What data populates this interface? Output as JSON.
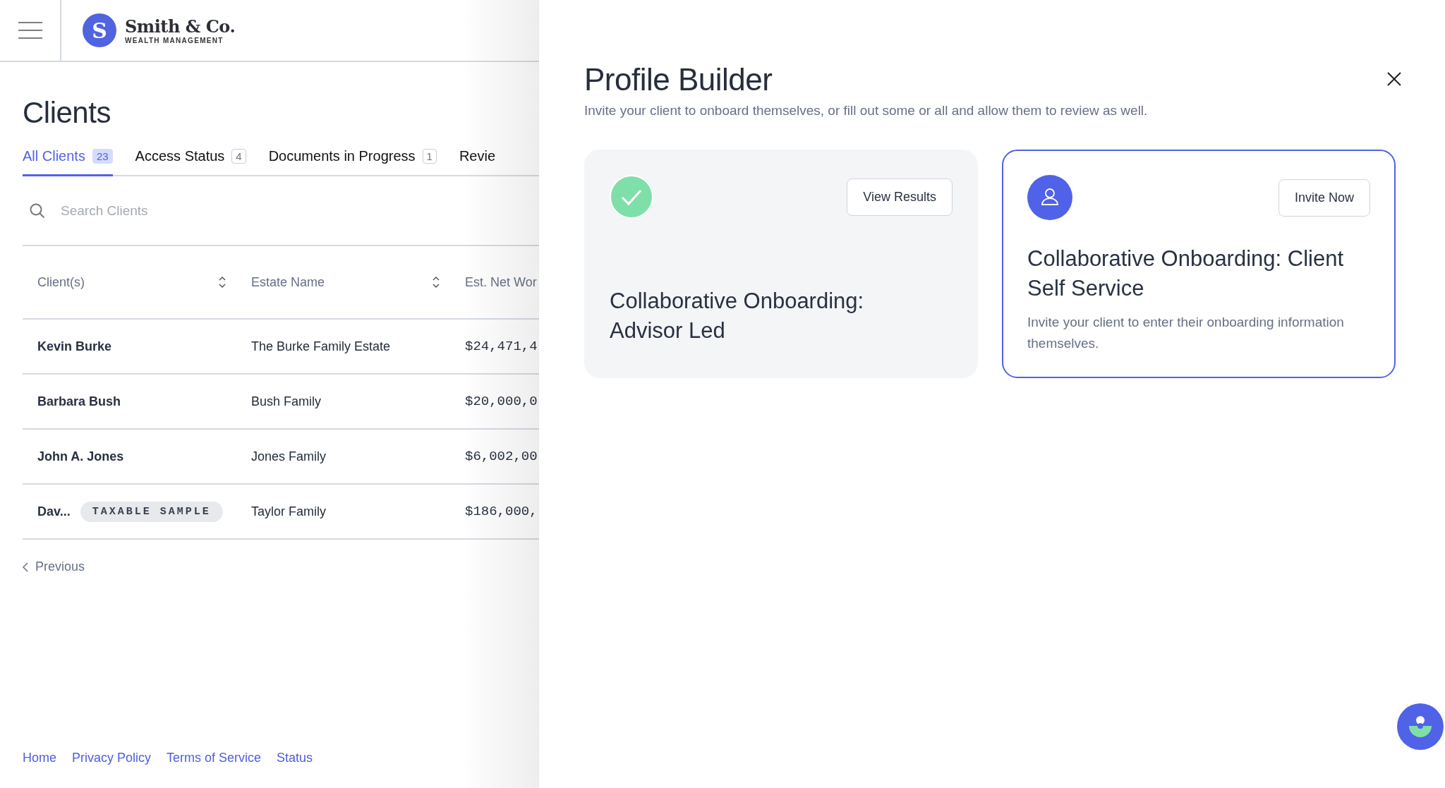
{
  "header": {
    "brand_initial": "S",
    "brand_name": "Smith & Co.",
    "brand_tagline": "WEALTH MANAGEMENT"
  },
  "page_title": "Clients",
  "tabs": [
    {
      "label": "All Clients",
      "count": "23",
      "selected": true
    },
    {
      "label": "Access Status",
      "count": "4",
      "selected": false
    },
    {
      "label": "Documents in Progress",
      "count": "1",
      "selected": false
    },
    {
      "label": "Revie",
      "selected": false
    }
  ],
  "search": {
    "placeholder": "Search Clients"
  },
  "table": {
    "columns": [
      {
        "label": "Client(s)",
        "sortable": true
      },
      {
        "label": "Estate Name",
        "sortable": true
      },
      {
        "label": "Est. Net Wor"
      }
    ],
    "rows": [
      {
        "client": "Kevin Burke",
        "estate": "The Burke Family Estate",
        "net_worth": "$24,471,4"
      },
      {
        "client": "Barbara Bush",
        "estate": "Bush Family",
        "net_worth": "$20,000,0"
      },
      {
        "client": "John A. Jones",
        "estate": "Jones Family",
        "net_worth": "$6,002,00"
      },
      {
        "client": "Dav...",
        "tag": "TAXABLE SAMPLE",
        "estate": "Taylor Family",
        "net_worth": "$186,000,"
      }
    ]
  },
  "pagination": {
    "previous": "Previous"
  },
  "footer_links": [
    "Home",
    "Privacy Policy",
    "Terms of Service",
    "Status"
  ],
  "panel": {
    "title": "Profile Builder",
    "subtitle": "Invite your client to onboard themselves, or fill out some or all and allow them to review as well.",
    "cards": [
      {
        "kind": "complete",
        "title": "Collaborative Onboarding: Advisor Led",
        "button": "View Results",
        "selected": false
      },
      {
        "kind": "invite",
        "title": "Collaborative Onboarding: Client Self Service",
        "description": "Invite your client to enter their onboarding information themselves.",
        "button": "Invite Now",
        "selected": true
      }
    ]
  }
}
